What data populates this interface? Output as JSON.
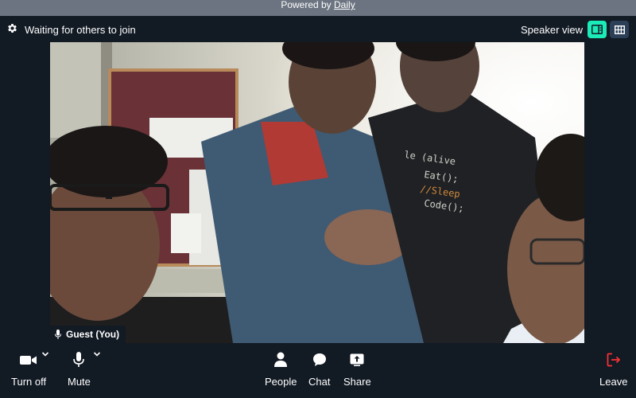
{
  "branding": {
    "prefix": "Powered by ",
    "link": "Daily"
  },
  "header": {
    "status": "Waiting for others to join",
    "view_label": "Speaker view",
    "icons": {
      "settings": "gear-icon",
      "speaker": "speaker-view-icon",
      "grid": "grid-view-icon"
    },
    "colors": {
      "accent": "#1bebb9",
      "inactive": "#2b3f56"
    }
  },
  "video": {
    "participant_name": "Guest (You)",
    "mic_icon": "microphone-icon"
  },
  "tray": {
    "camera_label": "Turn off",
    "mute_label": "Mute",
    "people_label": "People",
    "chat_label": "Chat",
    "share_label": "Share",
    "leave_label": "Leave",
    "colors": {
      "leave": "#f63135",
      "background": "#121a24"
    }
  }
}
